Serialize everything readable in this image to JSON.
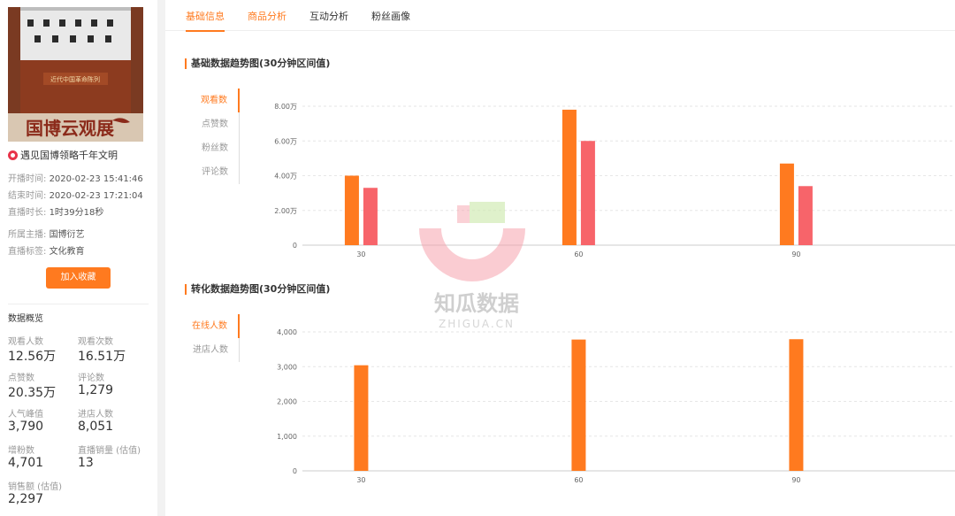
{
  "room": {
    "cover_text": "国博云观展",
    "cover_sign": "近代中国革命陈列",
    "title": "遇见国博领略千年文明",
    "start_label": "开播时间:",
    "start_value": "2020-02-23 15:41:46",
    "end_label": "结束时间:",
    "end_value": "2020-02-23 17:21:04",
    "duration_label": "直播时长:",
    "duration_value": "1时39分18秒",
    "host_label": "所属主播:",
    "host_value": "国博衍艺",
    "tag_label": "直播标签:",
    "tag_value": "文化教育",
    "fav_button": "加入收藏"
  },
  "overview": {
    "title": "数据概览",
    "stats": [
      {
        "label": "观看人数",
        "value": "12.56万"
      },
      {
        "label": "观看次数",
        "value": "16.51万"
      },
      {
        "label": "点赞数",
        "value": "20.35万"
      },
      {
        "label": "评论数",
        "value": "1,279"
      },
      {
        "label": "人气峰值",
        "value": "3,790"
      },
      {
        "label": "进店人数",
        "value": "8,051"
      },
      {
        "label": "增粉数",
        "value": "4,701"
      },
      {
        "label": "直播销量 (估值)",
        "value": "13"
      },
      {
        "label": "销售额 (估值)",
        "value": "2,297"
      }
    ]
  },
  "tabs": [
    "基础信息",
    "商品分析",
    "互动分析",
    "粉丝画像"
  ],
  "section1": {
    "title": "基础数据趋势图(30分钟区间值)",
    "side_tabs": [
      "观看数",
      "点赞数",
      "粉丝数",
      "评论数"
    ]
  },
  "section2": {
    "title": "转化数据趋势图(30分钟区间值)",
    "side_tabs": [
      "在线人数",
      "进店人数"
    ]
  },
  "watermark": {
    "cn": "知瓜数据",
    "en": "ZHIGUA.CN"
  },
  "colors": {
    "accent": "#ff7a1f",
    "secondary": "#f7646a"
  },
  "chart_data": [
    {
      "type": "bar",
      "categories": [
        "30",
        "60",
        "90"
      ],
      "series": [
        {
          "values": [
            40000,
            78000,
            47000
          ]
        },
        {
          "values": [
            33000,
            60000,
            34000
          ]
        }
      ],
      "yticks": [
        "0",
        "2.00万",
        "4.00万",
        "6.00万",
        "8.00万"
      ],
      "ylim": [
        0,
        80000
      ],
      "grid": true
    },
    {
      "type": "bar",
      "categories": [
        "30",
        "60",
        "90"
      ],
      "series": [
        {
          "values": [
            3040,
            3780,
            3790
          ]
        }
      ],
      "yticks": [
        "0",
        "1,000",
        "2,000",
        "3,000",
        "4,000"
      ],
      "ylim": [
        0,
        4000
      ],
      "grid": true
    }
  ]
}
